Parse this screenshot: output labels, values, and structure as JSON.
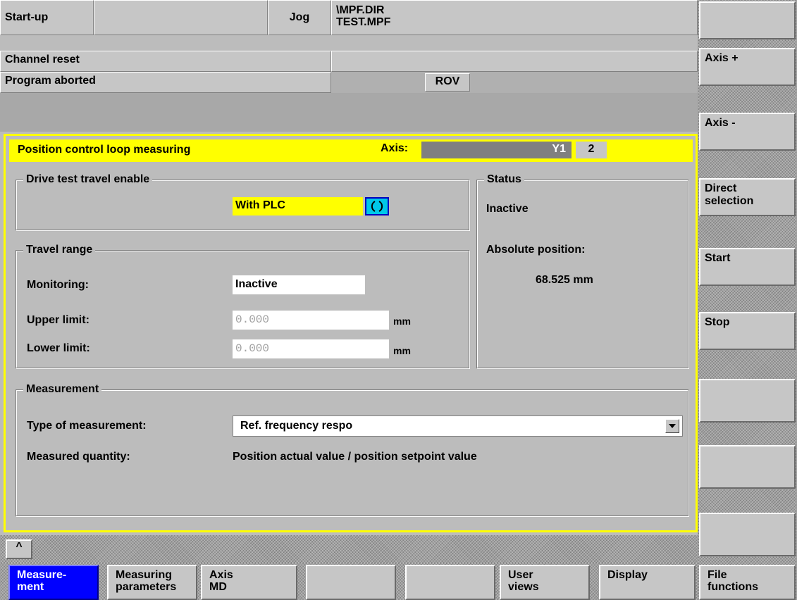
{
  "header": {
    "mode": "Start-up",
    "op_mode": "Jog",
    "path_line1": "\\MPF.DIR",
    "path_line2": "TEST.MPF",
    "channel_status": "Channel reset",
    "program_status": "Program aborted",
    "rov_label": "ROV"
  },
  "panel": {
    "title": "Position control loop measuring",
    "axis_label": "Axis:",
    "axis_name": "Y1",
    "axis_number": "2",
    "drive_test": {
      "legend": "Drive test travel enable",
      "value": "With PLC"
    },
    "travel_range": {
      "legend": "Travel range",
      "monitoring_label": "Monitoring:",
      "monitoring_value": "Inactive",
      "upper_label": "Upper limit:",
      "upper_value": "0.000",
      "lower_label": "Lower limit:",
      "lower_value": "0.000",
      "unit": "mm"
    },
    "status": {
      "legend": "Status",
      "state": "Inactive",
      "abs_pos_label": "Absolute position:",
      "abs_pos_value": "68.525 mm"
    },
    "measurement": {
      "legend": "Measurement",
      "type_label": "Type of measurement:",
      "type_value": "Ref. frequency respo",
      "quantity_label": "Measured quantity:",
      "quantity_value": "Position actual value / position setpoint value"
    }
  },
  "recall_label": "^",
  "vertical_softkeys": [
    "",
    "Axis +",
    "Axis -",
    "Direct\nselection",
    "Start",
    "Stop",
    "",
    "",
    ""
  ],
  "horizontal_softkeys": [
    "Measure-\nment",
    "Measuring\nparameters",
    "Axis\nMD",
    "",
    "",
    "User\nviews",
    "Display",
    "File\nfunctions"
  ],
  "colors": {
    "title_bar": "#ffff00",
    "active_softkey": "#0000ff",
    "axis_bar": "#808080"
  }
}
